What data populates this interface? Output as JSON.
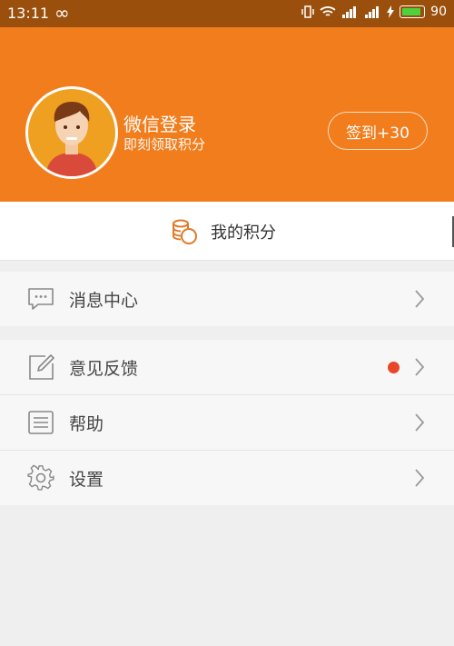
{
  "status_bar": {
    "time": "13:11",
    "battery_level": "90"
  },
  "header": {
    "login_title": "微信登录",
    "login_subtitle": "即刻领取积分",
    "signin_button": "签到+30"
  },
  "points": {
    "label": "我的积分"
  },
  "menu_groups": [
    {
      "items": [
        {
          "label": "消息中心",
          "icon": "message-icon"
        }
      ]
    },
    {
      "items": [
        {
          "label": "意见反馈",
          "icon": "edit-icon",
          "badge_dot": true
        },
        {
          "label": "帮助",
          "icon": "list-icon"
        },
        {
          "label": "设置",
          "icon": "gear-icon"
        }
      ]
    }
  ],
  "colors": {
    "accent": "#f27d1c",
    "status_bar": "#9a4f0d",
    "badge": "#e8472a"
  }
}
